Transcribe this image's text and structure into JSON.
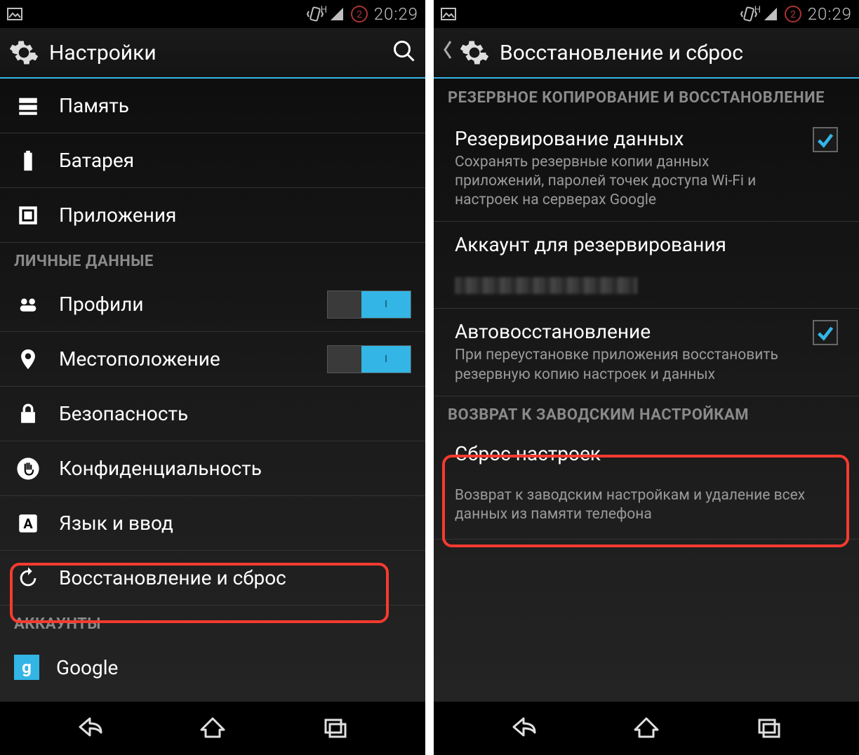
{
  "status": {
    "time": "20:29",
    "net_label": "H"
  },
  "left": {
    "title": "Настройки",
    "items_top": [
      {
        "icon": "storage",
        "label": "Память"
      },
      {
        "icon": "battery",
        "label": "Батарея"
      },
      {
        "icon": "apps",
        "label": "Приложения"
      }
    ],
    "section_personal": "ЛИЧНЫЕ ДАННЫЕ",
    "items_personal": [
      {
        "icon": "profile",
        "label": "Профили",
        "toggle": true
      },
      {
        "icon": "location",
        "label": "Местоположение",
        "toggle": true
      },
      {
        "icon": "lock",
        "label": "Безопасность"
      },
      {
        "icon": "hand",
        "label": "Конфиденциальность"
      },
      {
        "icon": "language",
        "label": "Язык и ввод"
      },
      {
        "icon": "restore",
        "label": "Восстановление и сброс"
      }
    ],
    "section_accounts": "АККАУНТЫ",
    "items_accounts": [
      {
        "icon": "google",
        "label": "Google"
      }
    ]
  },
  "right": {
    "title": "Восстановление и сброс",
    "section_backup": "РЕЗЕРВНОЕ КОПИРОВАНИЕ И ВОССТАНОВЛЕНИЕ",
    "backup_data": {
      "title": "Резервирование данных",
      "sub": "Сохранять резервные копии данных приложений, паролей точек доступа Wi-Fi и настроек на серверах Google",
      "checked": true
    },
    "backup_account": {
      "title": "Аккаунт для резервирования"
    },
    "auto_restore": {
      "title": "Автовосстановление",
      "sub": "При переустановке приложения восстановить резервную копию настроек и данных",
      "checked": true
    },
    "section_factory": "ВОЗВРАТ К ЗАВОДСКИМ НАСТРОЙКАМ",
    "factory_reset": {
      "title": "Сброс настроек",
      "sub": "Возврат к заводским настройкам и удаление всех данных из памяти телефона"
    }
  }
}
